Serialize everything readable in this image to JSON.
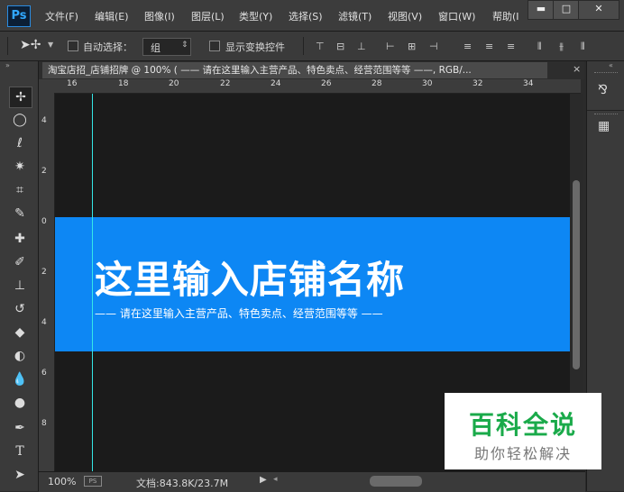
{
  "app": {
    "logo": "Ps"
  },
  "menu": [
    "文件(F)",
    "编辑(E)",
    "图像(I)",
    "图层(L)",
    "类型(Y)",
    "选择(S)",
    "滤镜(T)",
    "视图(V)",
    "窗口(W)",
    "帮助(I"
  ],
  "window_buttons": {
    "minimize": "▬",
    "restore": "□",
    "close": "✕"
  },
  "options": {
    "auto_select_label": "自动选择：",
    "auto_select_value": "组",
    "show_transform_label": "显示变换控件"
  },
  "document": {
    "tab_title": "淘宝店招_店铺招牌 @ 100% ( —— 请在这里输入主营产品、特色卖点、经营范围等等 ——, RGB/...",
    "tab_close": "×"
  },
  "rulers": {
    "horizontal": [
      "16",
      "18",
      "20",
      "22",
      "24",
      "26",
      "28",
      "30",
      "32",
      "34"
    ],
    "vertical": [
      "4",
      "2",
      "0",
      "2",
      "4",
      "6",
      "8"
    ]
  },
  "banner": {
    "title": "这里输入店铺名称",
    "subtitle": "—— 请在这里输入主营产品、特色卖点、经营范围等等 ——",
    "color": "#0d87f4"
  },
  "status": {
    "zoom": "100%",
    "doc_size": "文档:843.8K/23.7M"
  },
  "watermark": {
    "title": "百科全说",
    "subtitle": "助你轻松解决"
  }
}
